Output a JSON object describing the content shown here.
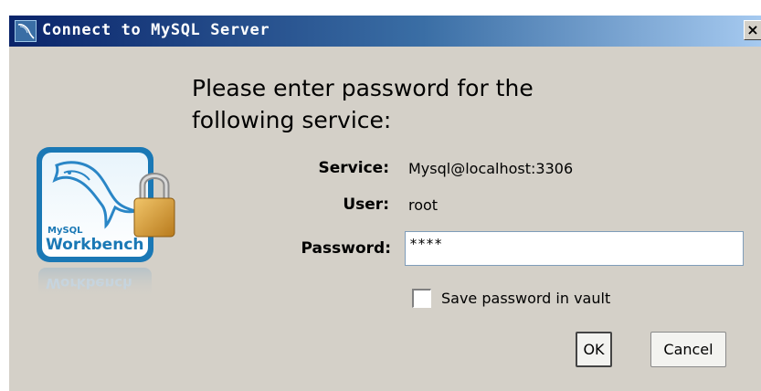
{
  "window": {
    "title": "Connect to MySQL Server",
    "close_glyph": "×"
  },
  "prompt": {
    "heading_line1": "Please enter password for the",
    "heading_line2": "following service:"
  },
  "logo": {
    "brand_small": "MySQL",
    "brand_big": "Workbench"
  },
  "form": {
    "service_label": "Service:",
    "service_value": "Mysql@localhost:3306",
    "user_label": "User:",
    "user_value": "root",
    "password_label": "Password:",
    "password_masked": "****",
    "save_password_label": "Save password in vault",
    "save_password_checked": false
  },
  "buttons": {
    "ok_label": "OK",
    "cancel_label": "Cancel"
  },
  "icons": [
    "mysql-workbench-logo-icon",
    "padlock-icon",
    "app-icon",
    "close-icon"
  ],
  "colors": {
    "dialog_bg": "#d4d0c8",
    "titlebar_start": "#0a246a",
    "titlebar_end": "#a6caf0",
    "logo_blue": "#1a78b5"
  }
}
